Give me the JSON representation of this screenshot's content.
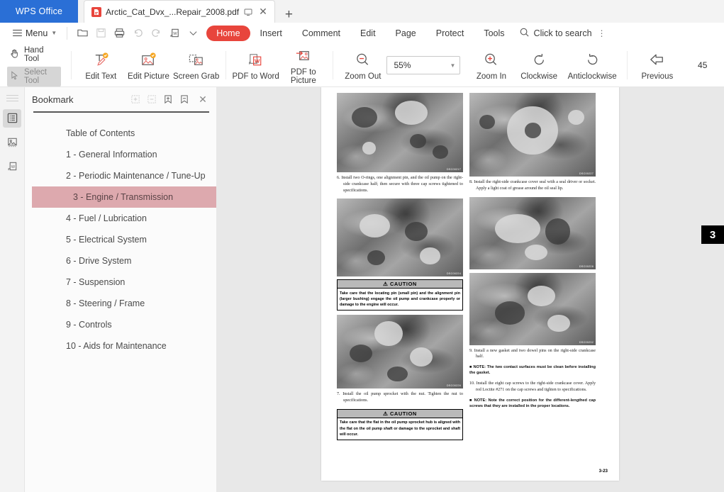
{
  "titlebar": {
    "brand": "WPS Office",
    "tab": {
      "filename": "Arctic_Cat_Dvx_...Repair_2008.pdf",
      "badge": "A",
      "monitor_icon": "monitor-icon",
      "close_icon": "✕"
    },
    "new_tab_label": "+"
  },
  "menubar": {
    "menu_label": "Menu",
    "quick_icons": [
      "open-folder-icon",
      "save-icon",
      "print-icon",
      "undo-icon",
      "redo-icon",
      "export-to-word-icon",
      "customize-caret-icon"
    ],
    "items": [
      {
        "label": "Home",
        "active": true
      },
      {
        "label": "Insert",
        "active": false
      },
      {
        "label": "Comment",
        "active": false
      },
      {
        "label": "Edit",
        "active": false
      },
      {
        "label": "Page",
        "active": false
      },
      {
        "label": "Protect",
        "active": false
      },
      {
        "label": "Tools",
        "active": false
      }
    ],
    "search_placeholder": "Click to search",
    "kebab": "⋮",
    "accent_color": "#e8453c"
  },
  "ribbon": {
    "hand_tool": "Hand Tool",
    "select_tool": "Select Tool",
    "buttons": [
      {
        "label": "Edit Text",
        "icon": "edit-text-icon"
      },
      {
        "label": "Edit Picture",
        "icon": "edit-picture-icon"
      },
      {
        "label": "Screen Grab",
        "icon": "screen-grab-icon"
      },
      {
        "label": "PDF to Word",
        "icon": "pdf-to-word-icon"
      },
      {
        "label": "PDF to Picture",
        "icon": "pdf-to-picture-icon"
      },
      {
        "label": "Zoom Out",
        "icon": "zoom-out-icon"
      }
    ],
    "zoom_value": "55%",
    "zoom_in": {
      "label": "Zoom In",
      "icon": "zoom-in-icon"
    },
    "clockwise": {
      "label": "Clockwise",
      "icon": "rotate-clockwise-icon"
    },
    "anticlockwise": {
      "label": "Anticlockwise",
      "icon": "rotate-anticlockwise-icon"
    },
    "previous": {
      "label": "Previous",
      "icon": "previous-arrow-icon"
    },
    "page_number": "45"
  },
  "rail": {
    "items": [
      {
        "name": "bookmark-panel-icon",
        "active": true
      },
      {
        "name": "thumbnails-panel-icon",
        "active": false
      },
      {
        "name": "convert-panel-icon",
        "active": false
      }
    ]
  },
  "bookmark_panel": {
    "title": "Bookmark",
    "tools": [
      {
        "name": "expand-all-icon",
        "disabled": true
      },
      {
        "name": "collapse-all-icon",
        "disabled": true
      },
      {
        "name": "add-bookmark-icon",
        "disabled": false
      },
      {
        "name": "delete-bookmark-icon",
        "disabled": false
      }
    ],
    "close_label": "✕",
    "selected_index": 3,
    "highlight_color": "#dda9ae",
    "items": [
      "Table of Contents",
      "1 - General Information",
      "2 - Periodic Maintenance / Tune-Up",
      "3 - Engine / Transmission",
      "4 - Fuel / Lubrication",
      "5 - Electrical System",
      "6 - Drive System",
      "7 - Suspension",
      "8 - Steering / Frame",
      "9 - Controls",
      "10 - Aids for Maintenance"
    ]
  },
  "document": {
    "chapter_tab": "3",
    "folio": "3-23",
    "left_column": {
      "photo1_code": "DSC00217",
      "step6": "6. Install two O-rings, one alignment pin, and the oil pump on the right-side crankcase half; then secure with three cap screws tightened to specifications.",
      "photo2_code": "DSC00224",
      "caution1_title": "CAUTION",
      "caution1_body": "Take care that the locating pin (small pin) and the alignment pin (larger bushing) engage the oil pump and crankcase properly or damage to the engine will occur.",
      "photo3_code": "DSC00226",
      "step7": "7. Install the oil pump sprocket with the nut. Tighten the nut to specifications.",
      "caution2_title": "CAUTION",
      "caution2_body": "Take care that the flat in the oil pump sprocket hub is aligned with the flat on the oil pump shaft or damage to the sprocket and shaft will occur."
    },
    "right_column": {
      "photo4_code": "DSC00227",
      "step8": "8. Install the right-side crankcase cover seal with a seal driver or socket. Apply a light coat of grease around the oil seal lip.",
      "photo5_code": "DSC00228",
      "photo6_code": "DSC00232",
      "step9": "9. Install a new gasket and two dowel pins on the right-side crankcase half.",
      "note1": "■ NOTE: The two contact surfaces must be clean before installing the gasket.",
      "step10": "10. Install the eight cap screws to the right-side crankcase cover. Apply red Loctite #271 on the cap screws and tighten to specifications.",
      "note2": "■ NOTE: Note the correct position for the different-lengthed cap screws that they are installed in the proper locations."
    }
  }
}
